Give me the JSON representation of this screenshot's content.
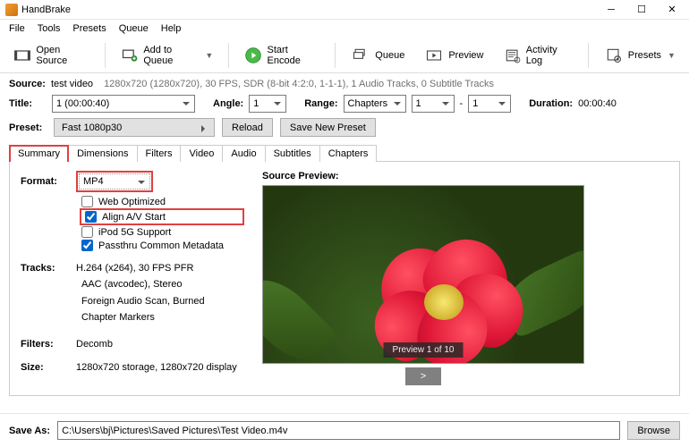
{
  "app": {
    "title": "HandBrake"
  },
  "menu": {
    "file": "File",
    "tools": "Tools",
    "presets": "Presets",
    "queue": "Queue",
    "help": "Help"
  },
  "toolbar": {
    "open_source": "Open Source",
    "add_queue": "Add to Queue",
    "start": "Start Encode",
    "queue": "Queue",
    "preview": "Preview",
    "activity": "Activity Log",
    "presets": "Presets"
  },
  "source": {
    "label": "Source:",
    "name": "test video",
    "info": "1280x720 (1280x720), 30 FPS, SDR (8-bit 4:2:0, 1-1-1), 1 Audio Tracks, 0 Subtitle Tracks"
  },
  "title": {
    "label": "Title:",
    "value": "1  (00:00:40)",
    "angle_label": "Angle:",
    "angle": "1",
    "range_label": "Range:",
    "range_type": "Chapters",
    "range_from": "1",
    "range_dash": "-",
    "range_to": "1",
    "duration_label": "Duration:",
    "duration": "00:00:40"
  },
  "preset": {
    "label": "Preset:",
    "value": "Fast 1080p30",
    "reload": "Reload",
    "save_new": "Save New Preset"
  },
  "tabs": {
    "summary": "Summary",
    "dimensions": "Dimensions",
    "filters": "Filters",
    "video": "Video",
    "audio": "Audio",
    "subtitles": "Subtitles",
    "chapters": "Chapters"
  },
  "summary": {
    "format_label": "Format:",
    "format": "MP4",
    "web_optimized": "Web Optimized",
    "align_av": "Align A/V Start",
    "ipod5g": "iPod 5G Support",
    "passthru": "Passthru Common Metadata",
    "tracks_label": "Tracks:",
    "tracks": {
      "video": "H.264 (x264), 30 FPS PFR",
      "audio": "AAC (avcodec), Stereo",
      "subs": "Foreign Audio Scan, Burned",
      "chapters": "Chapter Markers"
    },
    "filters_label": "Filters:",
    "filters": "Decomb",
    "size_label": "Size:",
    "size": "1280x720 storage, 1280x720 display",
    "preview_label": "Source Preview:",
    "preview_hud": "Preview 1 of 10",
    "next": ">"
  },
  "save": {
    "label": "Save As:",
    "path": "C:\\Users\\bj\\Pictures\\Saved Pictures\\Test Video.m4v",
    "browse": "Browse"
  }
}
